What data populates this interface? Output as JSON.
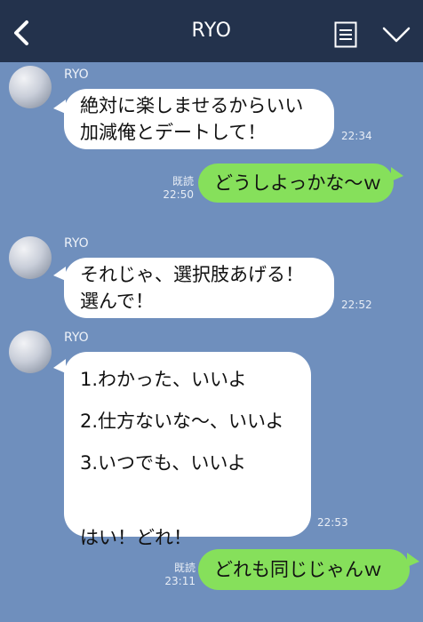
{
  "header": {
    "title": "RYO",
    "back_icon": "chevron-left-icon",
    "memo_icon": "memo-icon",
    "menu_icon": "chevron-down-icon"
  },
  "colors": {
    "background": "#6f8fbd",
    "header": "#23324c",
    "incoming_bubble": "#ffffff",
    "outgoing_bubble": "#86e05b"
  },
  "messages": [
    {
      "direction": "incoming",
      "sender": "RYO",
      "lines": [
        "絶対に楽しませるからいい",
        "加減俺とデートして！"
      ],
      "time": "22:34"
    },
    {
      "direction": "outgoing",
      "read": "既読",
      "lines": [
        "どうしよっかな〜ｗ"
      ],
      "time": "22:50"
    },
    {
      "direction": "incoming",
      "sender": "RYO",
      "lines": [
        "それじゃ、選択肢あげる！",
        "選んで！"
      ],
      "time": "22:52"
    },
    {
      "direction": "incoming",
      "sender": "RYO",
      "lines": [
        "1.わかった、いいよ",
        "2.仕方ないな〜、いいよ",
        "3.いつでも、いいよ",
        "",
        "はい！どれ！"
      ],
      "time": "22:53"
    },
    {
      "direction": "outgoing",
      "read": "既読",
      "lines": [
        "どれも同じじゃんｗ"
      ],
      "time": "23:11"
    }
  ]
}
